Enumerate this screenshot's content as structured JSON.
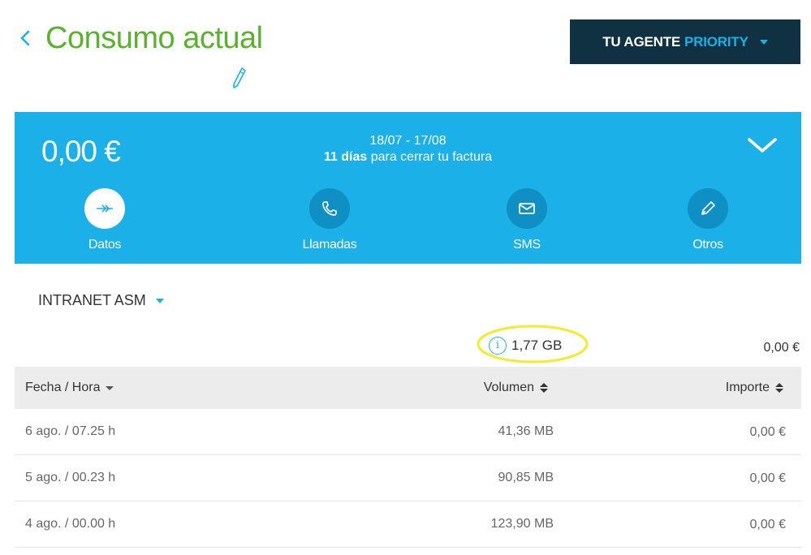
{
  "header": {
    "title": "Consumo actual",
    "agent_button": {
      "label": "TU AGENTE",
      "highlight": "PRIORITY"
    }
  },
  "summary": {
    "amount": "0,00 €",
    "period": "18/07 - 17/08",
    "days_bold": "11 días",
    "days_rest": " para cerrar tu factura",
    "tabs": [
      {
        "label": "Datos",
        "icon": "data-arrows-icon",
        "active": true
      },
      {
        "label": "Llamadas",
        "icon": "phone-icon",
        "active": false
      },
      {
        "label": "SMS",
        "icon": "envelope-icon",
        "active": false
      },
      {
        "label": "Otros",
        "icon": "pen-icon",
        "active": false
      }
    ]
  },
  "line": {
    "selected": "INTRANET ASM"
  },
  "totals": {
    "volume": "1,77 GB",
    "amount": "0,00 €"
  },
  "table": {
    "headers": {
      "fecha": "Fecha / Hora",
      "volumen": "Volumen",
      "importe": "Importe"
    },
    "rows": [
      {
        "fecha": "6 ago. / 07.25 h",
        "volumen": "41,36 MB",
        "importe": "0,00 €"
      },
      {
        "fecha": "5 ago. / 00.23 h",
        "volumen": "90,85 MB",
        "importe": "0,00 €"
      },
      {
        "fecha": "4 ago. / 00.00 h",
        "volumen": "123,90 MB",
        "importe": "0,00 €"
      }
    ]
  },
  "colors": {
    "brand_green": "#5bb12f",
    "brand_blue": "#1bb0e7",
    "dark_navy": "#0f3142",
    "highlight_yellow": "#f2ec2e"
  }
}
